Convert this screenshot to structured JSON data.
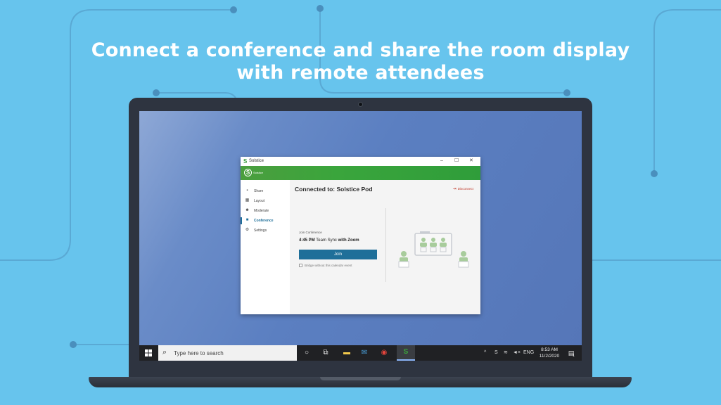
{
  "headline": {
    "line1": "Connect a conference and share the room display",
    "line2": "with remote attendees"
  },
  "colors": {
    "background": "#67c4ed",
    "brand_green": "#3aa53c",
    "accent_blue": "#1f6f99",
    "disconnect_red": "#c0392b"
  },
  "app": {
    "window_title": "Solstice",
    "brand_label": "Solstice",
    "controls": {
      "minimize": "–",
      "maximize": "☐",
      "close": "✕"
    },
    "nav": [
      {
        "label": "Share",
        "icon": "share-icon"
      },
      {
        "label": "Layout",
        "icon": "layout-icon"
      },
      {
        "label": "Moderate",
        "icon": "people-icon"
      },
      {
        "label": "Conference",
        "icon": "video-icon",
        "active": true
      },
      {
        "label": "Settings",
        "icon": "gear-icon"
      }
    ],
    "connected_title": "Connected to: Solstice Pod",
    "disconnect_label": "Disconnect",
    "join_conference_label": "Join Conference",
    "meeting": {
      "time": "4:45 PM",
      "name": "Team Sync",
      "with_word": "with",
      "platform": "Zoom"
    },
    "join_button": "Join",
    "bridge_checkbox_label": "Bridge without this calendar event",
    "bridge_checked": false
  },
  "taskbar": {
    "search_placeholder": "Type here to search",
    "language": "ENG",
    "time": "8:53 AM",
    "date": "11/2/2020",
    "notification_count": "1"
  }
}
